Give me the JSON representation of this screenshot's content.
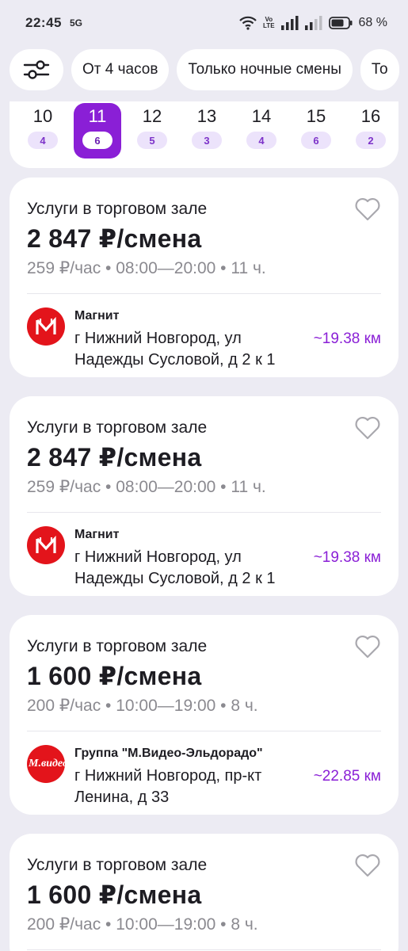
{
  "status_bar": {
    "time": "22:45",
    "net_badge": "5G",
    "volte_line1": "Vo",
    "volte_line2": "LTE",
    "battery": "68 %"
  },
  "filters": {
    "settings_icon": "filter-sliders-icon",
    "chips": [
      "От 4 часов",
      "Только ночные смены",
      "То"
    ]
  },
  "dates": [
    {
      "day": "10",
      "count": "4"
    },
    {
      "day": "11",
      "count": "6"
    },
    {
      "day": "12",
      "count": "5"
    },
    {
      "day": "13",
      "count": "3"
    },
    {
      "day": "14",
      "count": "4"
    },
    {
      "day": "15",
      "count": "6"
    },
    {
      "day": "16",
      "count": "2"
    }
  ],
  "selected_date": "11",
  "cards": [
    {
      "title": "Услуги в торговом зале",
      "price": "2 847 ₽/смена",
      "meta": "259 ₽/час  •  08:00—20:00  •  11 ч.",
      "company": "Магнит",
      "address": "г Нижний Новгород, ул Надежды Сусловой, д 2 к 1",
      "distance": "~19.38 км",
      "logo": "magnit-logo"
    },
    {
      "title": "Услуги в торговом зале",
      "price": "2 847 ₽/смена",
      "meta": "259 ₽/час  •  08:00—20:00  •  11 ч.",
      "company": "Магнит",
      "address": "г Нижний Новгород, ул Надежды Сусловой, д 2 к 1",
      "distance": "~19.38 км",
      "logo": "magnit-logo"
    },
    {
      "title": "Услуги в торговом зале",
      "price": "1 600 ₽/смена",
      "meta": "200 ₽/час  •  10:00—19:00  •  8 ч.",
      "company": "Группа \"М.Видео-Эльдорадо\"",
      "address": "г Нижний Новгород, пр-кт Ленина, д 33",
      "distance": "~22.85 км",
      "logo": "mvideo-logo",
      "logo_text": "М.видео"
    },
    {
      "title": "Услуги в торговом зале",
      "price": "1 600 ₽/смена",
      "meta": "200 ₽/час  •  10:00—19:00  •  8 ч."
    }
  ],
  "colors": {
    "accent": "#8a1fd6",
    "background": "#ecebf3",
    "brand_red": "#e3141b"
  }
}
